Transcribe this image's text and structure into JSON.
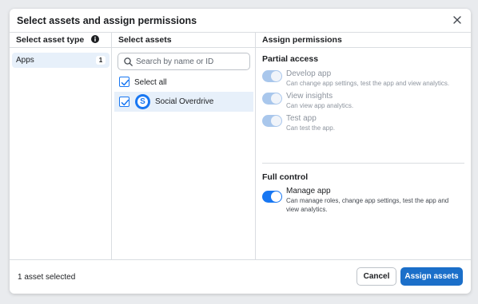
{
  "dialog": {
    "title": "Select assets and assign permissions"
  },
  "asset_types": {
    "header": "Select asset type",
    "items": [
      {
        "label": "Apps",
        "count": "1"
      }
    ]
  },
  "assets": {
    "header": "Select assets",
    "search_placeholder": "Search by name or ID",
    "select_all_label": "Select all",
    "select_all_checked": true,
    "items": [
      {
        "name": "Social Overdrive",
        "logo_letter": "S",
        "checked": true
      }
    ]
  },
  "permissions": {
    "header": "Assign permissions",
    "partial_access": {
      "title": "Partial access",
      "items": [
        {
          "name": "Develop app",
          "description": "Can change app settings, test the app and view analytics.",
          "enabled": true,
          "disabled_style": true
        },
        {
          "name": "View insights",
          "description": "Can view app analytics.",
          "enabled": true,
          "disabled_style": true
        },
        {
          "name": "Test app",
          "description": "Can test the app.",
          "enabled": true,
          "disabled_style": true
        }
      ]
    },
    "full_control": {
      "title": "Full control",
      "items": [
        {
          "name": "Manage app",
          "description": "Can manage roles, change app settings, test the app and view analytics.",
          "enabled": true,
          "disabled_style": false
        }
      ]
    }
  },
  "footer": {
    "selected_text": "1 asset selected",
    "cancel_label": "Cancel",
    "assign_label": "Assign assets"
  },
  "colors": {
    "accent": "#1877f2",
    "primary_button": "#1b6fc9",
    "selected_row": "#e7f0fa"
  }
}
